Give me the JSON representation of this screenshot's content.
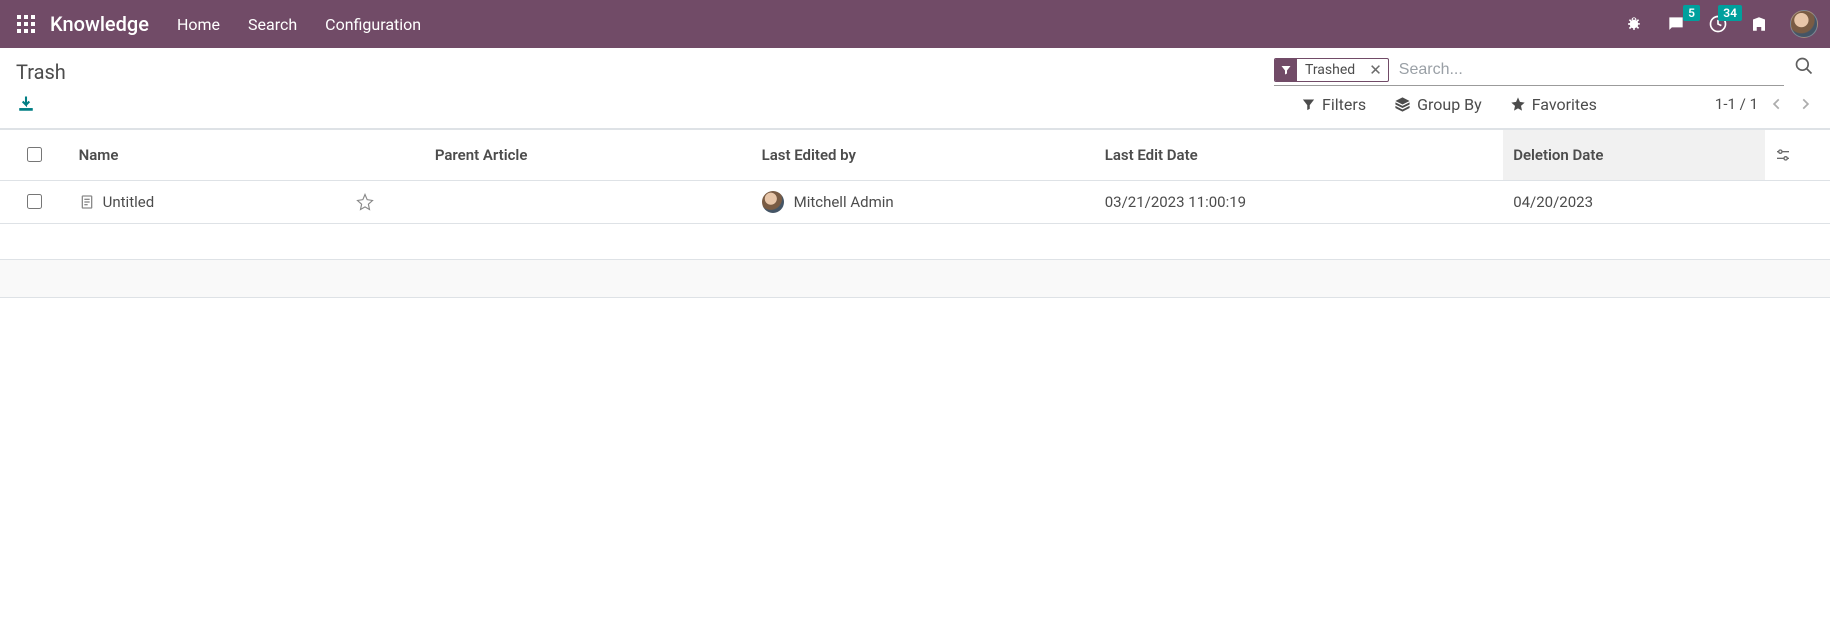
{
  "navbar": {
    "brand": "Knowledge",
    "links": [
      "Home",
      "Search",
      "Configuration"
    ],
    "messages_badge": "5",
    "activities_badge": "34"
  },
  "page": {
    "title": "Trash"
  },
  "search": {
    "facet_label": "Trashed",
    "placeholder": "Search...",
    "filters_label": "Filters",
    "groupby_label": "Group By",
    "favorites_label": "Favorites"
  },
  "pager": {
    "range": "1-1",
    "sep": " / ",
    "total": "1"
  },
  "table": {
    "headers": {
      "name": "Name",
      "parent": "Parent Article",
      "editor": "Last Edited by",
      "edit_date": "Last Edit Date",
      "del_date": "Deletion Date"
    },
    "rows": [
      {
        "name": "Untitled",
        "parent": "",
        "editor": "Mitchell Admin",
        "edit_date": "03/21/2023 11:00:19",
        "del_date": "04/20/2023"
      }
    ]
  }
}
